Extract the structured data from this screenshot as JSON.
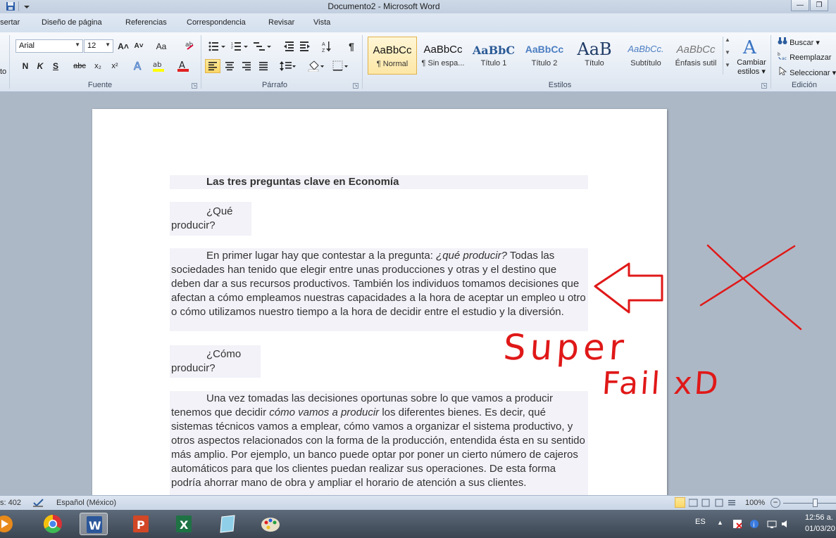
{
  "window": {
    "title": "Documento2 - Microsoft Word",
    "controls": [
      "—",
      "❐"
    ]
  },
  "tabs": [
    {
      "label": "Insertar"
    },
    {
      "label": "Diseño de página"
    },
    {
      "label": "Referencias"
    },
    {
      "label": "Correspondencia"
    },
    {
      "label": "Revisar"
    },
    {
      "label": "Vista"
    }
  ],
  "ribbon": {
    "font": {
      "name": "Arial",
      "size": "12",
      "group_label": "Fuente",
      "grow": "A˄",
      "shrink": "A˅",
      "case": "Aa",
      "bold": "N",
      "italic": "K",
      "underline": "S",
      "strike": "abc",
      "subscript": "x₂",
      "superscript": "x²",
      "font_color": "A",
      "accent_color": "#e02020",
      "highlight_color": "#ffff00"
    },
    "paragraph": {
      "group_label": "Párrafo",
      "show_marks": "¶"
    },
    "styles": {
      "group_label": "Estilos",
      "items": [
        {
          "sample": "AaBbCc",
          "name": "¶ Normal"
        },
        {
          "sample": "AaBbCc",
          "name": "¶ Sin espa..."
        },
        {
          "sample": "AaBbC",
          "name": "Título 1"
        },
        {
          "sample": "AaBbCc",
          "name": "Título 2"
        },
        {
          "sample": "AaB",
          "name": "Título"
        },
        {
          "sample": "AaBbCc.",
          "name": "Subtítulo"
        },
        {
          "sample": "AaBbCc",
          "name": "Énfasis sutil"
        }
      ],
      "change_styles": "Cambiar estilos",
      "change_styles_line1": "Cambiar",
      "change_styles_line2": "estilos ▾"
    },
    "editing": {
      "group_label": "Edición",
      "find": "Buscar ▾",
      "replace": "Reemplazar",
      "select": "Seleccionar ▾"
    }
  },
  "document": {
    "title": "Las tres preguntas clave en Economía",
    "q1_line1": "¿Qué",
    "q1_line2": "producir?",
    "p1_a": "En primer lugar hay que contestar a la pregunta: ",
    "p1_em": "¿qué producir?",
    "p1_b": " Todas las sociedades han tenido que elegir entre unas producciones y otras y el destino que deben dar a sus recursos productivos. También los individuos tomamos decisiones que afectan a cómo empleamos nuestras capacidades a la hora de aceptar un empleo u otro o cómo utilizamos nuestro tiempo a la hora de decidir entre el estudio y la diversión.",
    "q2_line1": "¿Cómo",
    "q2_line2": "producir?",
    "p2_a": "Una vez tomadas las decisiones oportunas sobre lo que vamos a producir tenemos que decidir ",
    "p2_em": "cómo vamos a producir",
    "p2_b": " los diferentes bienes. Es decir, qué sistemas técnicos vamos a emplear, cómo vamos a organizar el sistema productivo, y otros aspectos relacionados con la forma de la producción, entendida ésta en su sentido más amplio. Por ejemplo, un banco puede optar por poner un cierto número de cajeros automáticos para que los clientes puedan realizar sus operaciones. De esta forma podría ahorrar mano de obra y ampliar el horario de atención a sus clientes."
  },
  "annotation": {
    "color": "#e01818",
    "line1": "Super",
    "line2": "Fail xD"
  },
  "statusbar": {
    "words": "s: 402",
    "language": "Español (México)",
    "zoom": "100%"
  },
  "taskbar": {
    "language": "ES",
    "time": "12:56 a.",
    "date": "01/03/20"
  }
}
